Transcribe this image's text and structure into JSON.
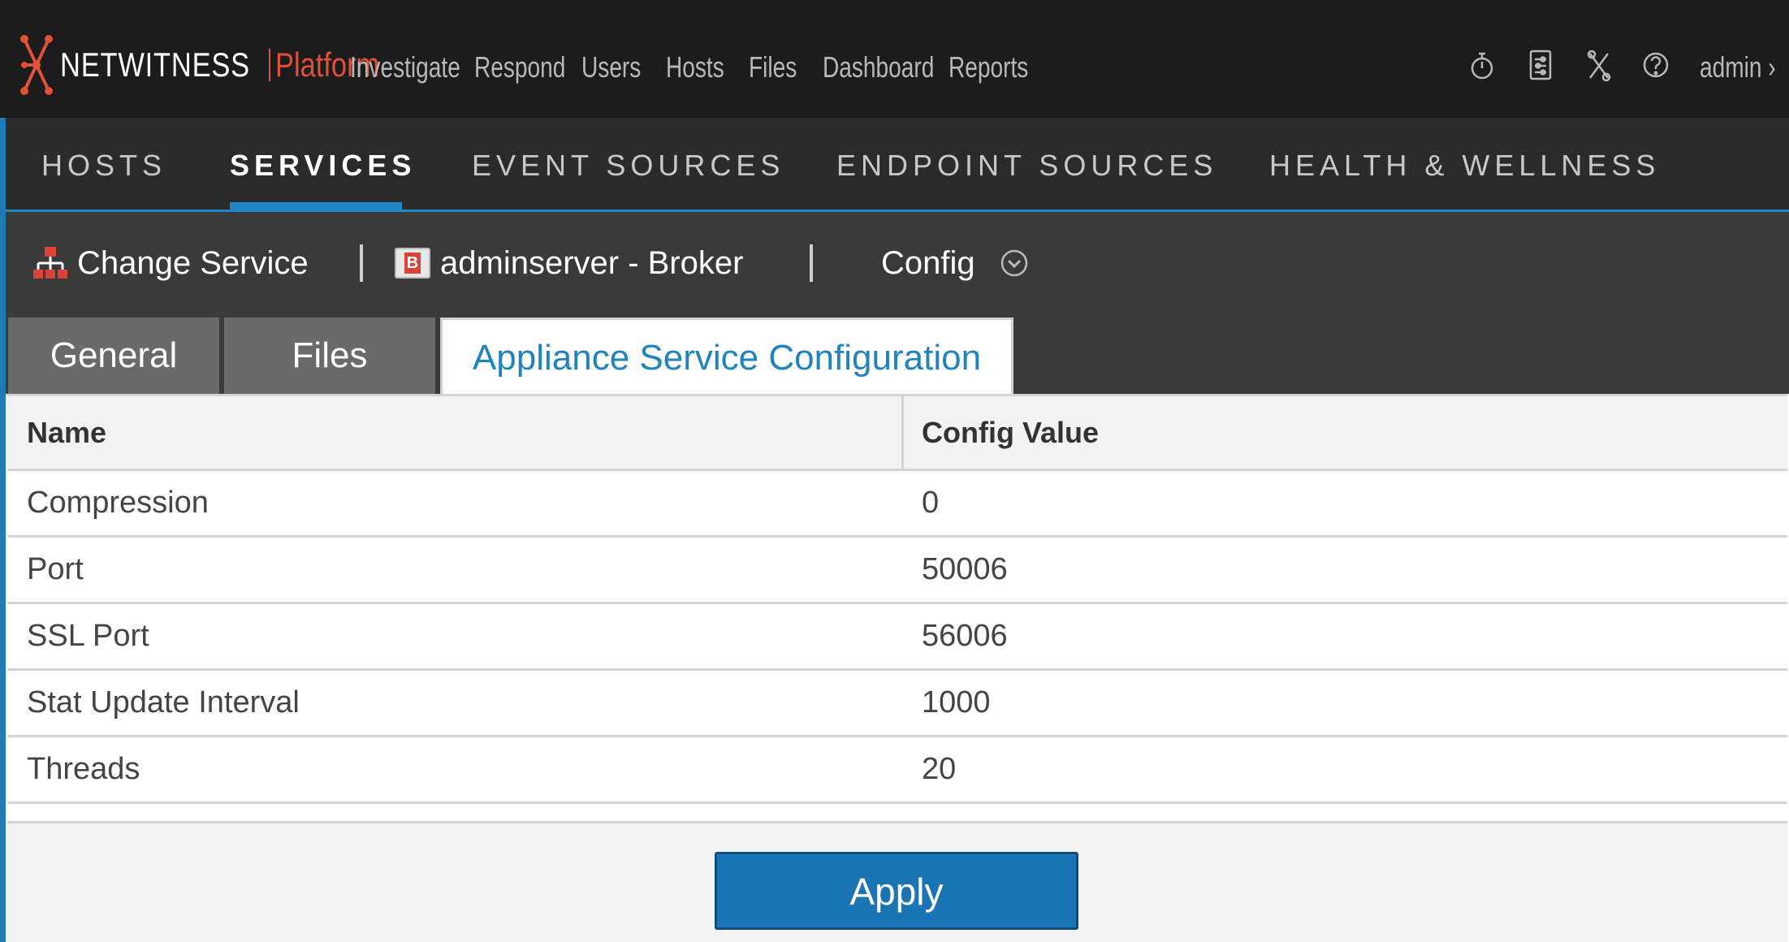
{
  "app": {
    "brand": "NETWITNESS",
    "product": "Platform",
    "accent_color": "#1f86c8",
    "brand_color": "#e0503a"
  },
  "top_nav": [
    "Investigate",
    "Respond",
    "Users",
    "Hosts",
    "Files",
    "Dashboard",
    "Reports"
  ],
  "top_icons": [
    "timer-icon",
    "settings-panel-icon",
    "tools-icon",
    "help-icon"
  ],
  "user": {
    "label": "admin",
    "chevron": "›"
  },
  "section_nav": {
    "items": [
      "HOSTS",
      "SERVICES",
      "EVENT SOURCES",
      "ENDPOINT SOURCES",
      "HEALTH & WELLNESS"
    ],
    "active": "SERVICES"
  },
  "service_bar": {
    "change_service": "Change Service",
    "service_name": "adminserver - Broker",
    "service_badge": "B",
    "view": "Config"
  },
  "tabs": {
    "items": [
      "General",
      "Files",
      "Appliance Service Configuration"
    ],
    "active": "Appliance Service Configuration"
  },
  "config_table": {
    "headers": [
      "Name",
      "Config Value"
    ],
    "rows": [
      [
        "Compression",
        "0"
      ],
      [
        "Port",
        "50006"
      ],
      [
        "SSL Port",
        "56006"
      ],
      [
        "Stat Update Interval",
        "1000"
      ],
      [
        "Threads",
        "20"
      ]
    ]
  },
  "actions": {
    "apply": "Apply"
  }
}
